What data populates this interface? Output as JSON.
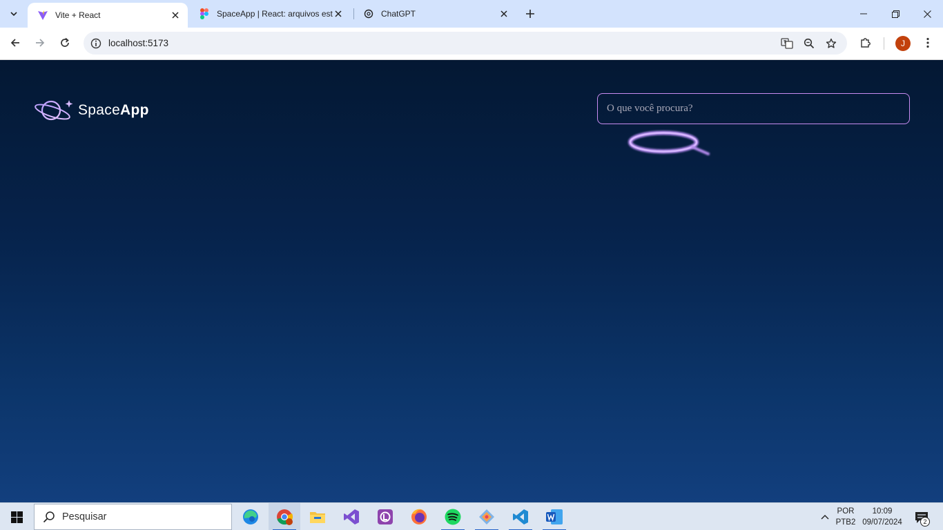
{
  "browser": {
    "tabs": [
      {
        "title": "Vite + React",
        "favicon": "vite-icon",
        "active": true
      },
      {
        "title": "SpaceApp | React: arquivos está",
        "favicon": "figma-icon",
        "active": false
      },
      {
        "title": "ChatGPT",
        "favicon": "chatgpt-icon",
        "active": false
      }
    ],
    "url": "localhost:5173",
    "profile_initial": "J"
  },
  "page": {
    "logo": {
      "part1": "Space",
      "part2": "App"
    },
    "search": {
      "placeholder": "O que você procura?",
      "value": ""
    }
  },
  "taskbar": {
    "search_label": "Pesquisar",
    "apps": [
      "edge-icon",
      "chrome-icon",
      "file-explorer-icon",
      "visual-studio-icon",
      "libre-icon",
      "firefox-icon",
      "spotify-icon",
      "git-icon",
      "vscode-icon",
      "word-icon"
    ],
    "lang_line1": "POR",
    "lang_line2": "PTB2",
    "time": "10:09",
    "date": "09/07/2024",
    "notification_count": "2"
  },
  "colors": {
    "page_bg_top": "#041833",
    "page_bg_bottom": "#123f7e",
    "accent": "#c98cf1"
  }
}
